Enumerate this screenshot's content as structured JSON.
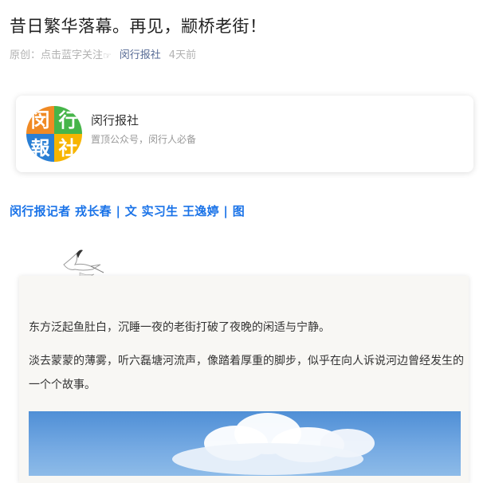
{
  "article": {
    "title": "昔日繁华落幕。再见，颛桥老街！",
    "meta": {
      "original_label": "原创：点击蓝字关注",
      "hand_icon": "pointing-hand-icon",
      "account": "闵行报社",
      "time": "4天前"
    },
    "account_card": {
      "logo_chars": [
        "闵",
        "行",
        "報",
        "社"
      ],
      "name": "闵行报社",
      "description": "置顶公众号，闵行人必备"
    },
    "byline": "闵行报记者 戎长春 | 文 实习生 王逸婷 | 图",
    "paragraphs": [
      "东方泛起鱼肚白，沉睡一夜的老街打破了夜晚的闲适与宁静。",
      "淡去蒙蒙的薄雾，听六磊塘河流声，像踏着厚重的脚步，似乎在向人诉说河边曾经发生的一个个故事。"
    ]
  },
  "colors": {
    "link_blue": "#576b95",
    "byline_blue": "#1a73e8",
    "logo_orange": "#f08a24",
    "logo_green": "#46b549",
    "logo_blue": "#2a7fd4",
    "logo_yellow": "#f7b500"
  }
}
